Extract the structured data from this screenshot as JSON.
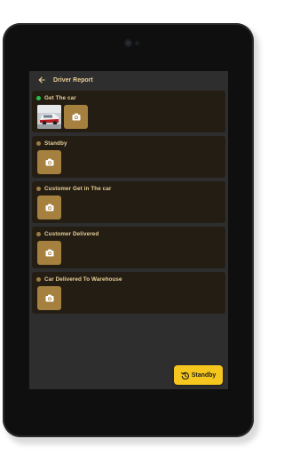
{
  "appbar": {
    "title": "Driver Report",
    "back_icon": "arrow-left-icon"
  },
  "colors": {
    "completed": "#27c04a",
    "pending": "#9b7b43",
    "card": "#241d14",
    "accent": "#a5803f",
    "button": "#f5c61d"
  },
  "steps": [
    {
      "label": "Get The car",
      "status": "completed",
      "has_photo": true
    },
    {
      "label": "Standby",
      "status": "pending",
      "has_photo": false
    },
    {
      "label": "Customer Get in The car",
      "status": "pending",
      "has_photo": false
    },
    {
      "label": "Customer Delivered",
      "status": "pending",
      "has_photo": false
    },
    {
      "label": "Car Delivered To Warehouse",
      "status": "pending",
      "has_photo": false
    }
  ],
  "action_button": {
    "label": "Standby",
    "icon": "history-icon"
  }
}
